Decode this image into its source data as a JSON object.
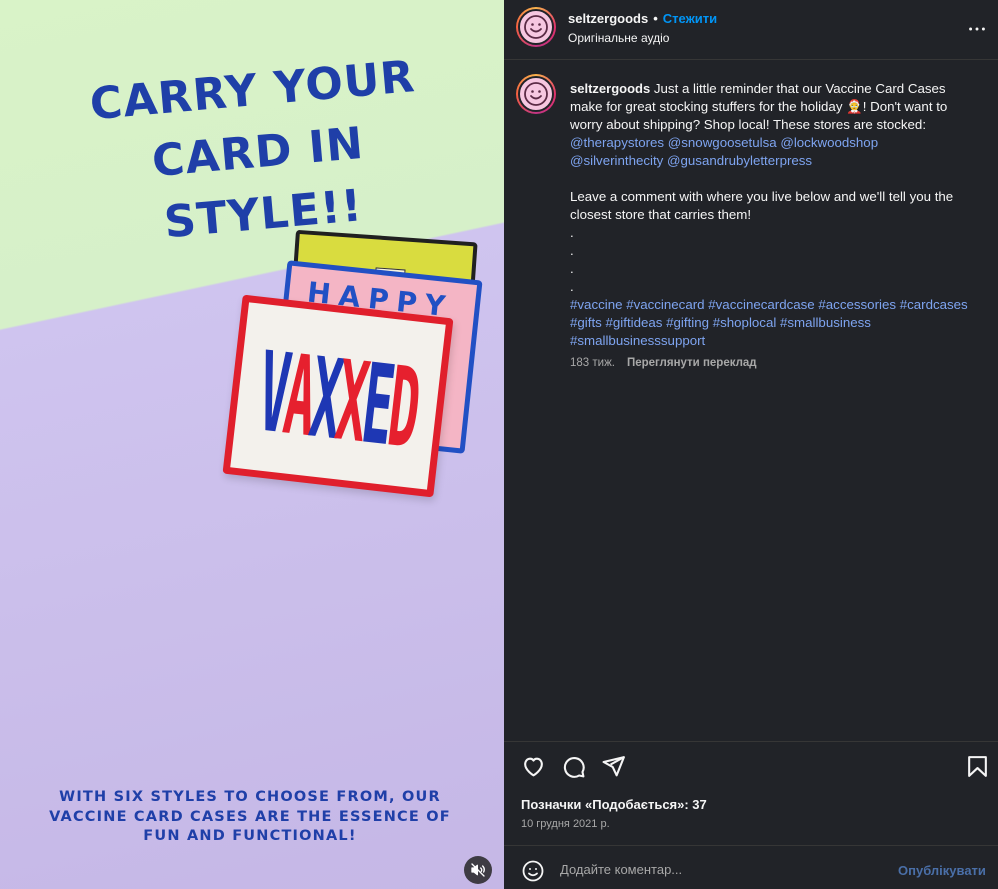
{
  "media": {
    "headline": "CARRY YOUR\nCARD IN STYLE!!",
    "footline": "WITH SIX STYLES TO CHOOSE FROM, OUR\nVACCINE CARD CASES ARE THE ESSENCE OF\nFUN AND FUNCTIONAL!",
    "card_tag": "VAXXED",
    "card_pink_word": "HAPPY",
    "card_white_letters": [
      "V",
      "A",
      "X",
      "X",
      "E",
      "D"
    ]
  },
  "header": {
    "username": "seltzergoods",
    "separator": "•",
    "follow_label": "Стежити",
    "audio": "Оригінальне аудіо"
  },
  "caption": {
    "username": "seltzergoods",
    "text1": "Just a little reminder that our Vaccine Card Cases make for great stocking stuffers for the holiday 🤶! Don't want to worry about shipping? Shop local! These stores are stocked:",
    "mentions": [
      "@therapystores",
      "@snowgoosetulsa",
      "@lockwoodshop",
      "@silverinthecity",
      "@gusandrubyletterpress"
    ],
    "text2": "Leave a comment with where you live below and we'll tell you the closest store that carries them!",
    "dots": [
      ".",
      ".",
      ".",
      "."
    ],
    "hashtags": [
      "#vaccine",
      "#vaccinecard",
      "#vaccinecardcase",
      "#accessories",
      "#cardcases",
      "#gifts",
      "#giftideas",
      "#gifting",
      "#shoplocal",
      "#smallbusiness",
      "#smallbusinesssupport"
    ],
    "age": "183 тиж.",
    "translate_label": "Переглянути переклад"
  },
  "actions": {
    "icons": [
      "heart-icon",
      "comment-icon",
      "share-icon",
      "bookmark-icon"
    ]
  },
  "likes": "Позначки «Подобається»: 37",
  "date": "10 грудня 2021 р.",
  "comment": {
    "placeholder": "Додайте коментар...",
    "post_label": "Опублікувати"
  },
  "colors": {
    "panel_bg": "#212328",
    "accent_blue": "#0095f6",
    "link_blue": "#7ea4f0",
    "media_blue_text": "#1f3fa8"
  }
}
